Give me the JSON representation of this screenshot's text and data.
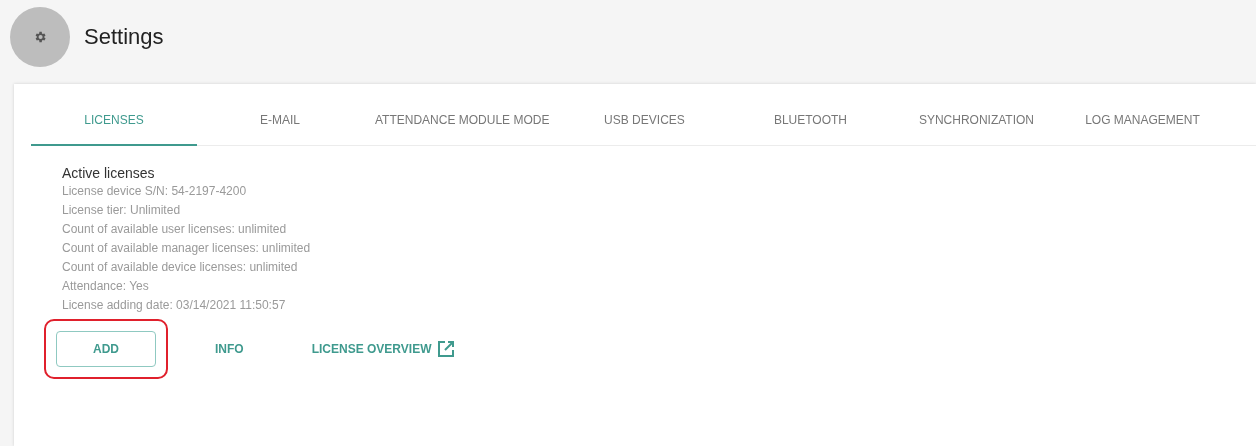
{
  "header": {
    "title": "Settings"
  },
  "tabs": [
    {
      "label": "LICENSES",
      "selected": true
    },
    {
      "label": "E-MAIL",
      "selected": false
    },
    {
      "label": "ATTENDANCE MODULE MODE",
      "selected": false
    },
    {
      "label": "USB DEVICES",
      "selected": false
    },
    {
      "label": "BLUETOOTH",
      "selected": false
    },
    {
      "label": "SYNCHRONIZATION",
      "selected": false
    },
    {
      "label": "LOG MANAGEMENT",
      "selected": false
    }
  ],
  "section": {
    "title": "Active licenses",
    "lines": [
      "License device S/N: 54-2197-4200",
      "License tier: Unlimited",
      "Count of available user licenses: unlimited",
      "Count of available manager licenses: unlimited",
      "Count of available device licenses: unlimited",
      "Attendance: Yes",
      "License adding date: 03/14/2021 11:50:57"
    ]
  },
  "actions": [
    {
      "label": "ADD",
      "kind": "outlined",
      "highlighted": true
    },
    {
      "label": "INFO",
      "kind": "text",
      "highlighted": false
    },
    {
      "label": "LICENSE OVERVIEW",
      "kind": "external",
      "highlighted": false
    }
  ]
}
